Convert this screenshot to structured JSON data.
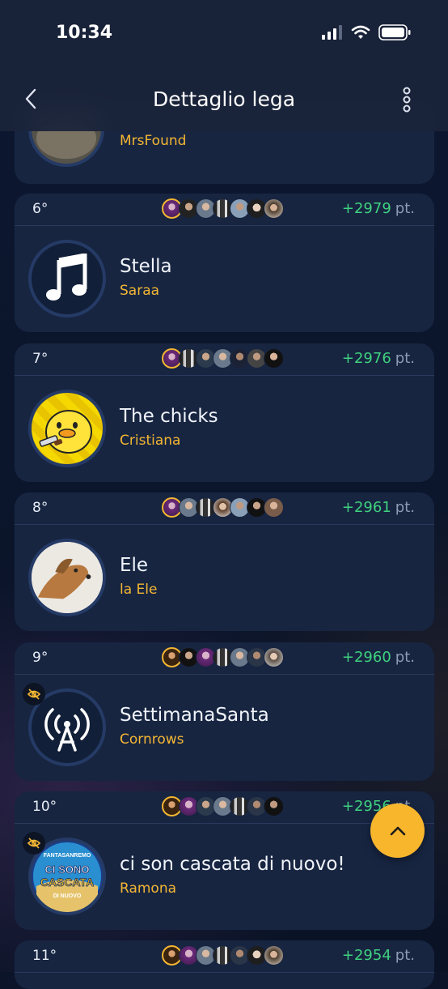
{
  "status_bar": {
    "time": "10:34"
  },
  "header": {
    "title": "Dettaglio lega"
  },
  "partial_top": {
    "user": "MrsFound"
  },
  "teams": [
    {
      "rank": "6°",
      "points": "+2979",
      "unit": "pt.",
      "team": "Stella",
      "user": "Saraa",
      "logo": "music-note-icon",
      "hidden": false
    },
    {
      "rank": "7°",
      "points": "+2976",
      "unit": "pt.",
      "team": "The chicks",
      "user": "Cristiana",
      "logo": "duck-with-knife-icon",
      "hidden": false
    },
    {
      "rank": "8°",
      "points": "+2961",
      "unit": "pt.",
      "team": "Ele",
      "user": "la Ele",
      "logo": "dog-photo",
      "hidden": false
    },
    {
      "rank": "9°",
      "points": "+2960",
      "unit": "pt.",
      "team": "SettimanaSanta",
      "user": "Cornrows",
      "logo": "antenna-broadcast-icon",
      "hidden": true
    },
    {
      "rank": "10°",
      "points": "+2956",
      "unit": "pt.",
      "team": "ci son cascata di nuovo!",
      "user": "Ramona",
      "logo": "fantasanremo-badge",
      "hidden": true
    },
    {
      "rank": "11°",
      "points": "+2954",
      "unit": "pt.",
      "team": "",
      "user": "",
      "logo": "",
      "hidden": false
    }
  ],
  "fantasanremo_badge": {
    "line1": "FANTASANREMO",
    "line2": "CI SONO",
    "line3": "CASCATA",
    "line4": "DI NUOVO"
  },
  "colors": {
    "accent": "#f4b633",
    "points": "#3fd27f",
    "card": "#172541",
    "background": "#0b1428"
  }
}
